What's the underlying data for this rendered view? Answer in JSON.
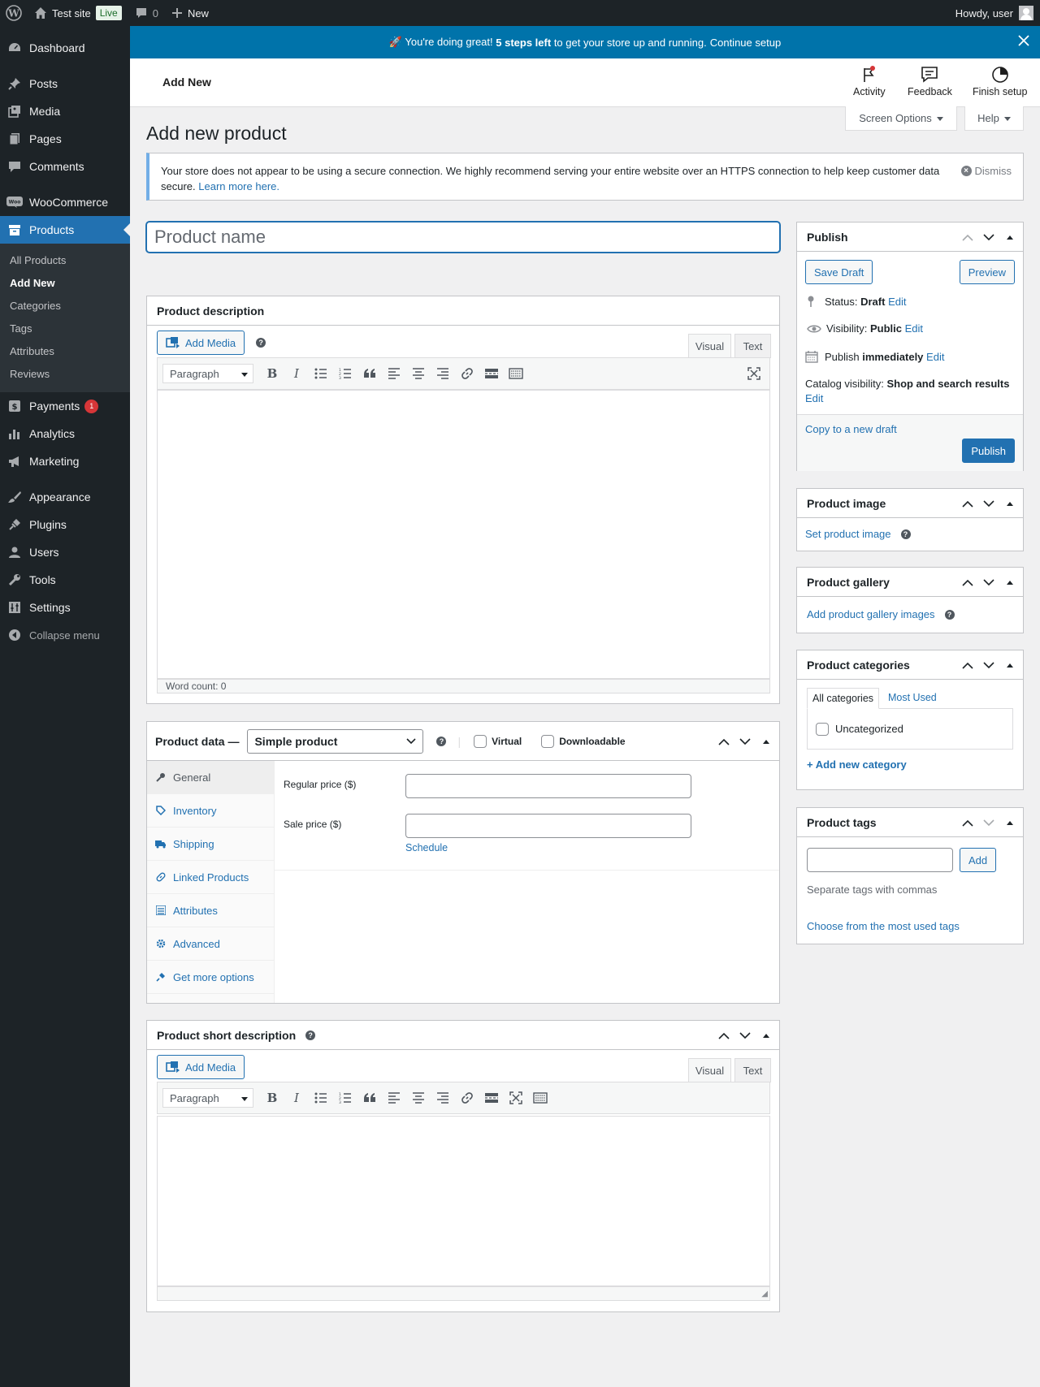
{
  "adminbar": {
    "site_name": "Test site",
    "live_badge": "Live",
    "comments_count": "0",
    "new_label": "New",
    "howdy": "Howdy, user"
  },
  "sidebar": {
    "items": [
      {
        "label": "Dashboard",
        "icon": "dashboard-icon"
      },
      {
        "label": "Posts",
        "icon": "pin-icon"
      },
      {
        "label": "Media",
        "icon": "media-icon"
      },
      {
        "label": "Pages",
        "icon": "pages-icon"
      },
      {
        "label": "Comments",
        "icon": "comment-icon"
      },
      {
        "label": "WooCommerce",
        "icon": "woo-icon"
      },
      {
        "label": "Products",
        "icon": "archive-icon"
      },
      {
        "label": "Payments",
        "icon": "payments-icon",
        "badge": "1"
      },
      {
        "label": "Analytics",
        "icon": "chart-icon"
      },
      {
        "label": "Marketing",
        "icon": "megaphone-icon"
      },
      {
        "label": "Appearance",
        "icon": "brush-icon"
      },
      {
        "label": "Plugins",
        "icon": "plugin-icon"
      },
      {
        "label": "Users",
        "icon": "user-icon"
      },
      {
        "label": "Tools",
        "icon": "wrench-icon"
      },
      {
        "label": "Settings",
        "icon": "settings-icon"
      }
    ],
    "products_submenu": [
      "All Products",
      "Add New",
      "Categories",
      "Tags",
      "Attributes",
      "Reviews"
    ],
    "collapse_label": "Collapse menu"
  },
  "setup_banner": {
    "prefix": "🚀 You're doing great!",
    "bold": "5 steps left",
    "suffix": "to get your store up and running.",
    "link": "Continue setup"
  },
  "header": {
    "title": "Add New",
    "activity": "Activity",
    "feedback": "Feedback",
    "finish_setup": "Finish setup"
  },
  "screen_options": "Screen Options",
  "help": "Help",
  "page_title": "Add new product",
  "https_notice": {
    "text": "Your store does not appear to be using a secure connection. We highly recommend serving your entire website over an HTTPS connection to help keep customer data secure.",
    "link": "Learn more here.",
    "dismiss": "Dismiss"
  },
  "product_name_placeholder": "Product name",
  "description_box": {
    "title": "Product description",
    "add_media": "Add Media",
    "tab_visual": "Visual",
    "tab_text": "Text",
    "format": "Paragraph",
    "word_count": "Word count: 0"
  },
  "product_data": {
    "title": "Product data —",
    "type": "Simple product",
    "virtual": "Virtual",
    "downloadable": "Downloadable",
    "tabs": [
      "General",
      "Inventory",
      "Shipping",
      "Linked Products",
      "Attributes",
      "Advanced",
      "Get more options"
    ],
    "regular_price_label": "Regular price ($)",
    "sale_price_label": "Sale price ($)",
    "schedule": "Schedule"
  },
  "short_description_box": {
    "title": "Product short description",
    "add_media": "Add Media",
    "tab_visual": "Visual",
    "tab_text": "Text",
    "format": "Paragraph"
  },
  "publish_box": {
    "title": "Publish",
    "save_draft": "Save Draft",
    "preview": "Preview",
    "status_label": "Status:",
    "status_value": "Draft",
    "visibility_label": "Visibility:",
    "visibility_value": "Public",
    "publish_label": "Publish",
    "publish_value": "immediately",
    "catalog_label": "Catalog visibility:",
    "catalog_value": "Shop and search results",
    "edit": "Edit",
    "copy_draft": "Copy to a new draft",
    "publish_button": "Publish"
  },
  "product_image_box": {
    "title": "Product image",
    "link": "Set product image"
  },
  "product_gallery_box": {
    "title": "Product gallery",
    "link": "Add product gallery images"
  },
  "categories_box": {
    "title": "Product categories",
    "tab_all": "All categories",
    "tab_most_used": "Most Used",
    "category": "Uncategorized",
    "add_new": "+ Add new category"
  },
  "tags_box": {
    "title": "Product tags",
    "add_button": "Add",
    "hint": "Separate tags with commas",
    "choose_link": "Choose from the most used tags"
  },
  "colors": {
    "admin_dark": "#1d2327",
    "accent": "#2271b1",
    "banner": "#0073aa"
  }
}
